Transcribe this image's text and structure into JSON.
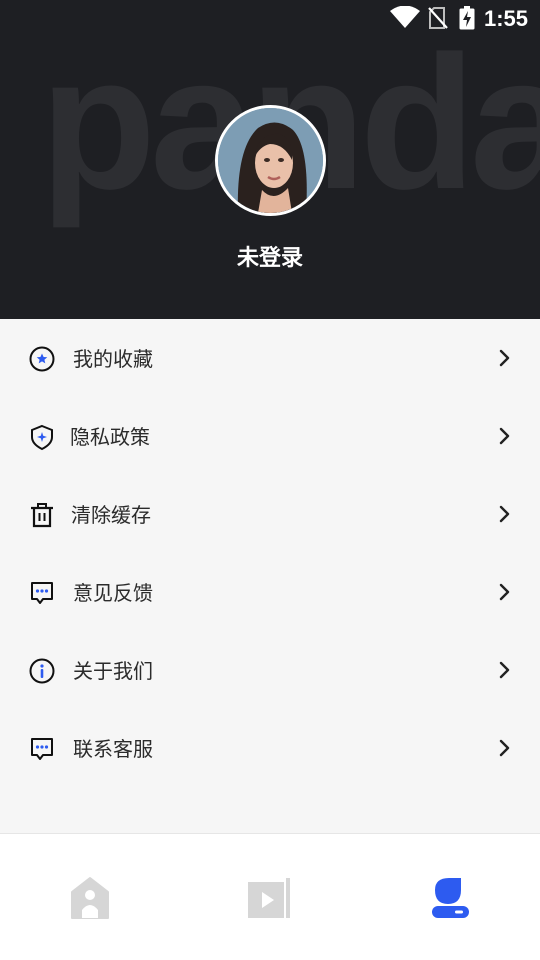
{
  "status_bar": {
    "time": "1:55",
    "icons": [
      "wifi-icon",
      "no-sim-icon",
      "battery-charging-icon"
    ]
  },
  "header": {
    "watermark": "panda",
    "username": "未登录"
  },
  "menu": {
    "items": [
      {
        "label": "我的收藏",
        "icon": "favorite-star-icon"
      },
      {
        "label": "隐私政策",
        "icon": "privacy-shield-icon"
      },
      {
        "label": "清除缓存",
        "icon": "trash-icon"
      },
      {
        "label": "意见反馈",
        "icon": "feedback-chat-icon"
      },
      {
        "label": "关于我们",
        "icon": "info-icon"
      },
      {
        "label": "联系客服",
        "icon": "customer-service-chat-icon"
      }
    ]
  },
  "tab_bar": {
    "tabs": [
      {
        "name": "home",
        "icon": "home-icon",
        "active": false
      },
      {
        "name": "video",
        "icon": "video-icon",
        "active": false
      },
      {
        "name": "profile",
        "icon": "profile-icon",
        "active": true
      }
    ],
    "active_color": "#2d5bf0",
    "inactive_color": "#d6d6d6"
  },
  "colors": {
    "header_bg": "#1e1f23",
    "accent": "#2d5bf0"
  }
}
